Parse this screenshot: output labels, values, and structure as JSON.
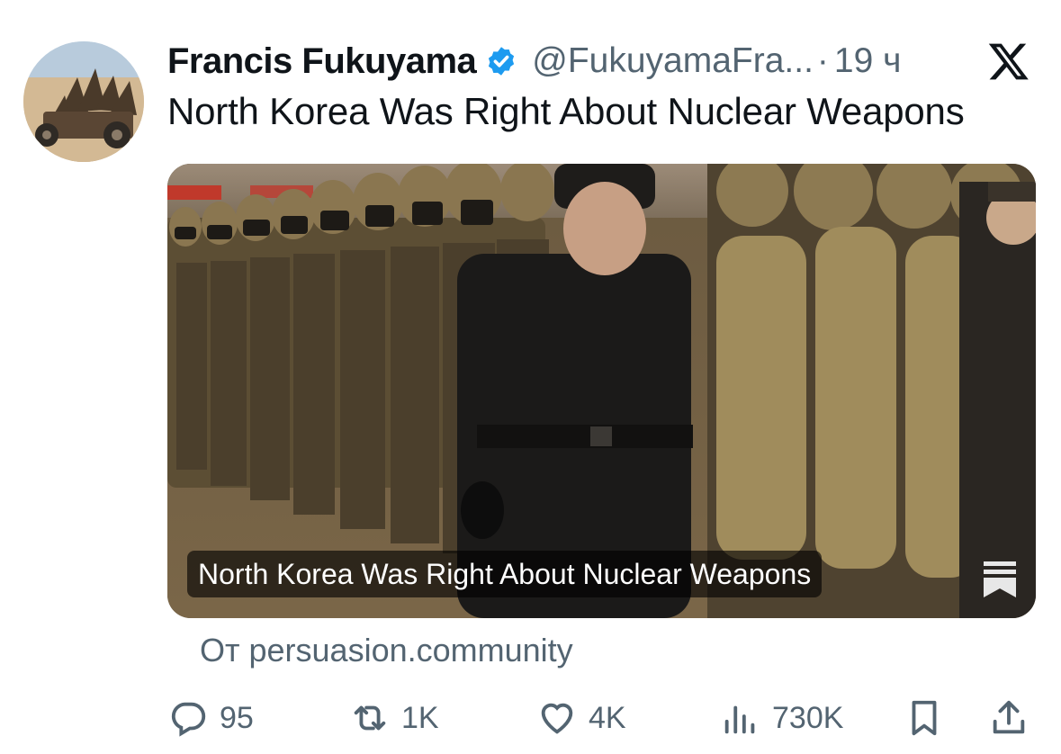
{
  "author": {
    "name": "Francis Fukuyama",
    "handle": "@FukuyamaFra...",
    "separator": "·",
    "time": "19 ч"
  },
  "tweet": {
    "text": "North Korea Was Right About Nuclear Weapons"
  },
  "card": {
    "caption": "North Korea Was Right About Nuclear Weapons",
    "source": "От persuasion.community"
  },
  "actions": {
    "replies": "95",
    "reposts": "1K",
    "likes": "4K",
    "views": "730K"
  },
  "colors": {
    "verified": "#1d9bf0",
    "muted": "#536471",
    "text": "#0f1419"
  },
  "icons": [
    "verified-badge-icon",
    "x-logo-icon",
    "bookmark-icon",
    "reply-icon",
    "repost-icon",
    "like-icon",
    "views-icon",
    "share-icon"
  ]
}
